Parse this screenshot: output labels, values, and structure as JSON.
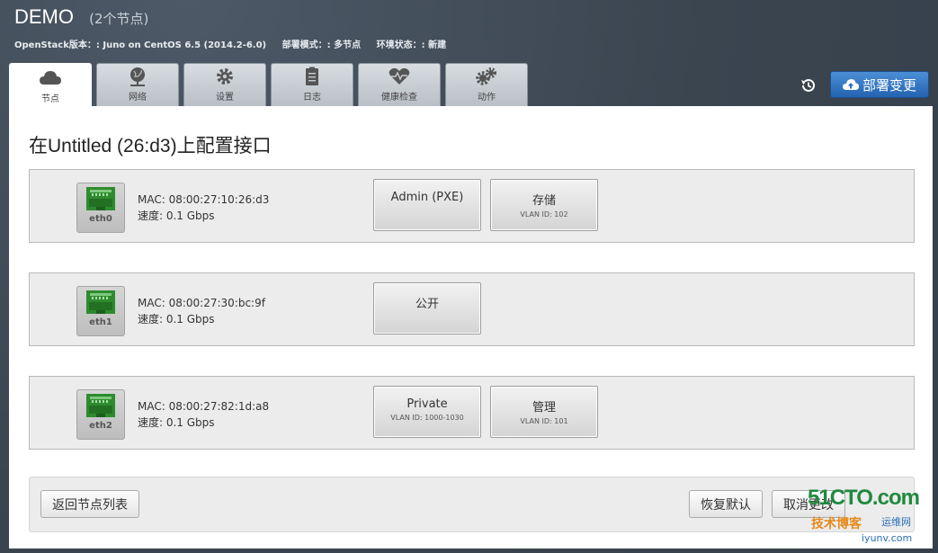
{
  "env": {
    "name": "DEMO",
    "node_count": "(2个节点)",
    "meta": [
      "OpenStack版本：: Juno on CentOS 6.5 (2014.2-6.0)",
      "部署模式：: 多节点",
      "环境状态：: 新建"
    ]
  },
  "tabs": [
    {
      "label": "节点",
      "icon": "cloud-icon",
      "active": true
    },
    {
      "label": "网络",
      "icon": "globe-network-icon"
    },
    {
      "label": "设置",
      "icon": "gear-icon"
    },
    {
      "label": "日志",
      "icon": "clipboard-icon"
    },
    {
      "label": "健康检查",
      "icon": "heart-pulse-icon"
    },
    {
      "label": "动作",
      "icon": "gears-icon"
    }
  ],
  "toolbar": {
    "history_icon": "history-icon",
    "deploy_label": "部署变更",
    "deploy_icon": "cloud-upload-icon",
    "deploy_color": "#2a6ec0"
  },
  "page": {
    "title": "在Untitled (26:d3)上配置接口"
  },
  "interfaces": [
    {
      "name": "eth0",
      "mac": "MAC: 08:00:27:10:26:d3",
      "speed": "速度: 0.1 Gbps",
      "networks": [
        {
          "name": "Admin (PXE)",
          "vlan": ""
        },
        {
          "name": "存储",
          "vlan": "VLAN ID: 102"
        }
      ]
    },
    {
      "name": "eth1",
      "mac": "MAC: 08:00:27:30:bc:9f",
      "speed": "速度: 0.1 Gbps",
      "networks": [
        {
          "name": "公开",
          "vlan": ""
        }
      ]
    },
    {
      "name": "eth2",
      "mac": "MAC: 08:00:27:82:1d:a8",
      "speed": "速度: 0.1 Gbps",
      "networks": [
        {
          "name": "Private",
          "vlan": "VLAN ID: 1000-1030"
        },
        {
          "name": "管理",
          "vlan": "VLAN ID: 101"
        }
      ]
    }
  ],
  "footer": {
    "back_label": "返回节点列表",
    "reset_label": "恢复默认",
    "cancel_label": "取消更改"
  },
  "watermark": {
    "line1": "51CTO.com",
    "line2": "技术博客",
    "line3": "运维网",
    "line4": "iyunv.com"
  },
  "colors": {
    "nic_port": "#2e8b2e",
    "header_bg": "#3f4a56"
  }
}
